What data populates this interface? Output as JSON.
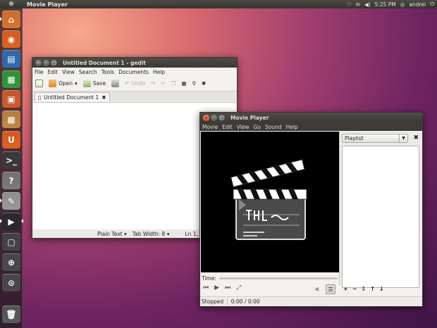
{
  "topbar": {
    "app_title": "Movie Player",
    "time": "5:25 PM",
    "user": "andrei"
  },
  "launcher": {
    "items": [
      {
        "name": "home-folder-icon",
        "color": "#d9742f",
        "glyph": "⌂"
      },
      {
        "name": "firefox-icon",
        "color": "#e0621e",
        "glyph": "◉"
      },
      {
        "name": "writer-icon",
        "color": "#2d6db5",
        "glyph": "▤"
      },
      {
        "name": "calc-icon",
        "color": "#2f9a3b",
        "glyph": "▦"
      },
      {
        "name": "impress-icon",
        "color": "#d35b2d",
        "glyph": "▣"
      },
      {
        "name": "software-center-icon",
        "color": "#c28844",
        "glyph": "▩"
      },
      {
        "name": "ubuntu-one-icon",
        "color": "#e2601f",
        "glyph": "U"
      },
      {
        "name": "terminal-icon",
        "color": "#3a3a3a",
        "glyph": ">_"
      },
      {
        "name": "help-icon",
        "color": "#7a7a7a",
        "glyph": "?"
      },
      {
        "name": "text-editor-icon",
        "color": "#9a9a9a",
        "glyph": "✎"
      },
      {
        "name": "movie-player-icon",
        "color": "#2a2a2a",
        "glyph": "▶"
      },
      {
        "name": "workspaces-icon",
        "color": "#444444",
        "glyph": "▢"
      },
      {
        "name": "apps-lens-icon",
        "color": "#4a4a4a",
        "glyph": "⊕"
      },
      {
        "name": "files-lens-icon",
        "color": "#4a4a4a",
        "glyph": "⊙"
      },
      {
        "name": "trash-icon",
        "color": "#5a5a5a",
        "glyph": "🗑"
      }
    ]
  },
  "gedit": {
    "title": "Untitled Document 1 - gedit",
    "menu": [
      "File",
      "Edit",
      "View",
      "Search",
      "Tools",
      "Documents",
      "Help"
    ],
    "toolbar": {
      "open": "Open",
      "save": "Save",
      "undo": "Undo"
    },
    "tab": "Untitled Document 1",
    "status": {
      "language": "Plain Text",
      "tab_width_label": "Tab Width:",
      "tab_width": "8",
      "position": "Ln 1,"
    }
  },
  "movie": {
    "title": "Movie Player",
    "menu": [
      "Movie",
      "Edit",
      "View",
      "Go",
      "Sound",
      "Help"
    ],
    "playlist_label": "Playlist",
    "time_label": "Time:",
    "status": "Stopped",
    "time": "0:00 / 0:00"
  }
}
